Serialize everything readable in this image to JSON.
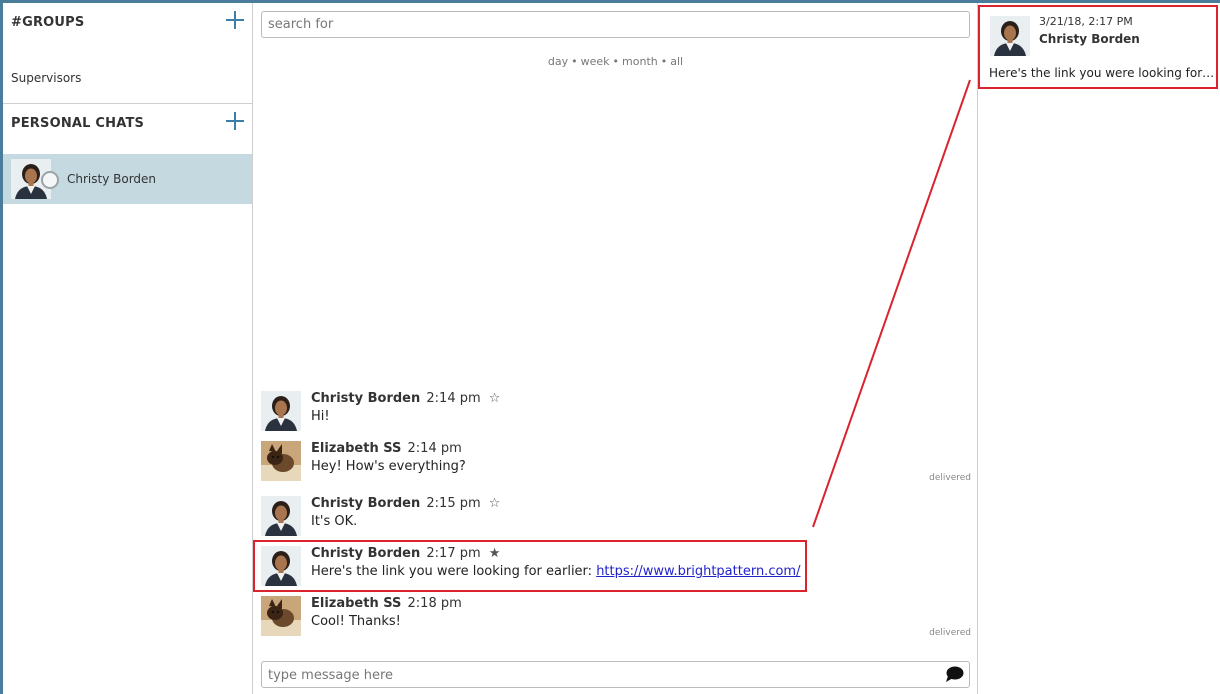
{
  "sidebar": {
    "groups_title": "#GROUPS",
    "groups": [
      {
        "label": "Supervisors"
      }
    ],
    "personal_title": "PERSONAL CHATS",
    "personal": [
      {
        "label": "Christy Borden"
      }
    ]
  },
  "search": {
    "placeholder": "search for"
  },
  "filters": [
    "day",
    "week",
    "month",
    "all"
  ],
  "filter_separator": "•",
  "messages": [
    {
      "author": "Christy Borden",
      "time": "2:14 pm",
      "star": "☆",
      "text": "Hi!",
      "status": "",
      "avatar": "christy"
    },
    {
      "author": "Elizabeth SS",
      "time": "2:14 pm",
      "star": "",
      "text": "Hey! How's everything?",
      "status": "delivered",
      "avatar": "elizabeth"
    },
    {
      "author": "Christy Borden",
      "time": "2:15 pm",
      "star": "☆",
      "text": "It's OK.",
      "status": "",
      "avatar": "christy"
    },
    {
      "author": "Christy Borden",
      "time": "2:17 pm",
      "star": "★",
      "text": "Here's the link you were looking for earlier: ",
      "link": "https://www.brightpattern.com/",
      "status": "",
      "avatar": "christy"
    },
    {
      "author": "Elizabeth SS",
      "time": "2:18 pm",
      "star": "",
      "text": "Cool! Thanks!",
      "status": "delivered",
      "avatar": "elizabeth"
    }
  ],
  "composer": {
    "placeholder": "type message here"
  },
  "favorites": [
    {
      "date": "3/21/18, 2:17 PM",
      "name": "Christy Borden",
      "text": "Here's the link you were looking for earlier: https://www.brightpattern.com/"
    }
  ],
  "colors": {
    "accent": "#3c7fa6",
    "frame": "#4a7d99",
    "selected_chat": "#c5d9e1",
    "highlight": "#d9232d",
    "link": "#2222cc"
  },
  "icons": [
    "add-group-icon",
    "add-chat-icon",
    "presence-icon",
    "star-icon",
    "send-chat-icon"
  ]
}
